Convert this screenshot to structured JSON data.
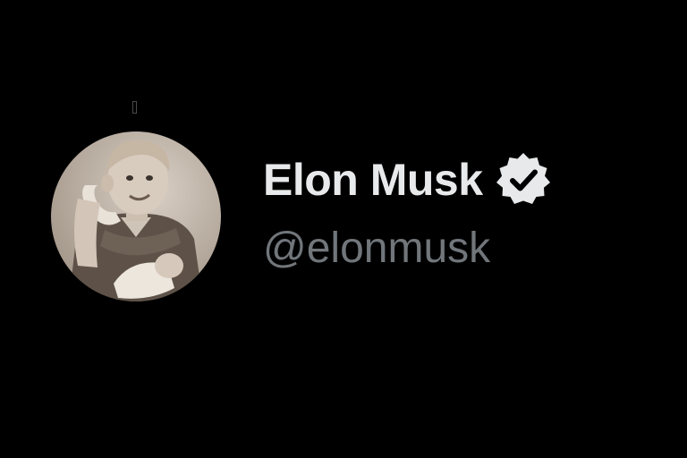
{
  "profile": {
    "display_name": "Elon Musk",
    "handle": "@elonmusk",
    "verified": true,
    "verified_icon": "verified-badge-icon",
    "avatar_icon": "profile-photo"
  },
  "colors": {
    "background": "#000000",
    "name": "#e7e9ea",
    "handle": "#71767b",
    "badge": "#e7e9ea"
  }
}
